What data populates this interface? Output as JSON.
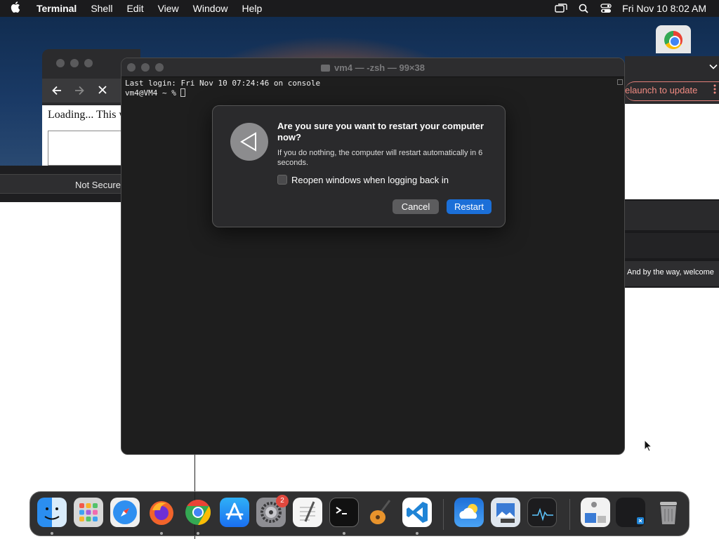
{
  "menubar": {
    "app_name": "Terminal",
    "menus": [
      "Shell",
      "Edit",
      "View",
      "Window",
      "Help"
    ],
    "datetime": "Fri Nov 10  8:02 AM"
  },
  "browser": {
    "loading_text": "Loading... This w",
    "not_secure": "Not Secure",
    "relaunch_text": "elaunch to update",
    "welcome_text": "And by the way, welcome"
  },
  "terminal": {
    "title": "vm4 — -zsh — 99×38",
    "lines": [
      "Last login: Fri Nov 10 07:24:46 on console",
      "vm4@VM4 ~ % "
    ]
  },
  "dialog": {
    "heading": "Are you sure you want to restart your computer now?",
    "message": "If you do nothing, the computer will restart automatically in 6 seconds.",
    "checkbox_label": "Reopen windows when logging back in",
    "checkbox_checked": false,
    "cancel_label": "Cancel",
    "restart_label": "Restart",
    "accent_color": "#1b6fd8"
  },
  "dock": {
    "apps": [
      {
        "name": "finder-icon",
        "running": true
      },
      {
        "name": "launchpad-icon",
        "running": false
      },
      {
        "name": "safari-icon",
        "running": false
      },
      {
        "name": "firefox-icon",
        "running": true
      },
      {
        "name": "chrome-icon",
        "running": true
      },
      {
        "name": "app-store-icon",
        "running": false
      },
      {
        "name": "system-settings-icon",
        "running": false,
        "badge": "2"
      },
      {
        "name": "textedit-icon",
        "running": false
      },
      {
        "name": "terminal-icon",
        "running": true
      },
      {
        "name": "garageband-icon",
        "running": false
      },
      {
        "name": "vscode-icon",
        "running": true
      },
      {
        "name": "weather-icon",
        "running": false
      },
      {
        "name": "preview-icon",
        "running": false
      },
      {
        "name": "activity-monitor-icon",
        "running": false
      },
      {
        "name": "downloads-stack-icon",
        "running": false
      },
      {
        "name": "recent-window-icon",
        "running": false
      },
      {
        "name": "trash-icon",
        "running": false
      }
    ]
  }
}
